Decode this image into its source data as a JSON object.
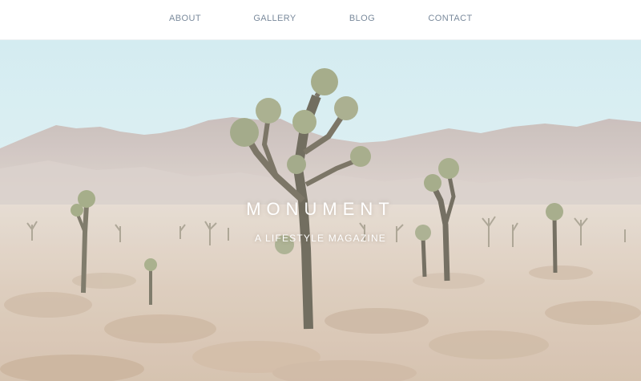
{
  "nav": {
    "items": [
      {
        "label": "ABOUT"
      },
      {
        "label": "GALLERY"
      },
      {
        "label": "BLOG"
      },
      {
        "label": "CONTACT"
      }
    ]
  },
  "hero": {
    "brand": "MONUMENT",
    "tagline": "A LIFESTYLE MAGAZINE"
  },
  "colors": {
    "nav_text": "#7a8a9c",
    "sky": "#d9eef2",
    "ground": "#d8c8b8",
    "hero_text": "#ffffff"
  }
}
